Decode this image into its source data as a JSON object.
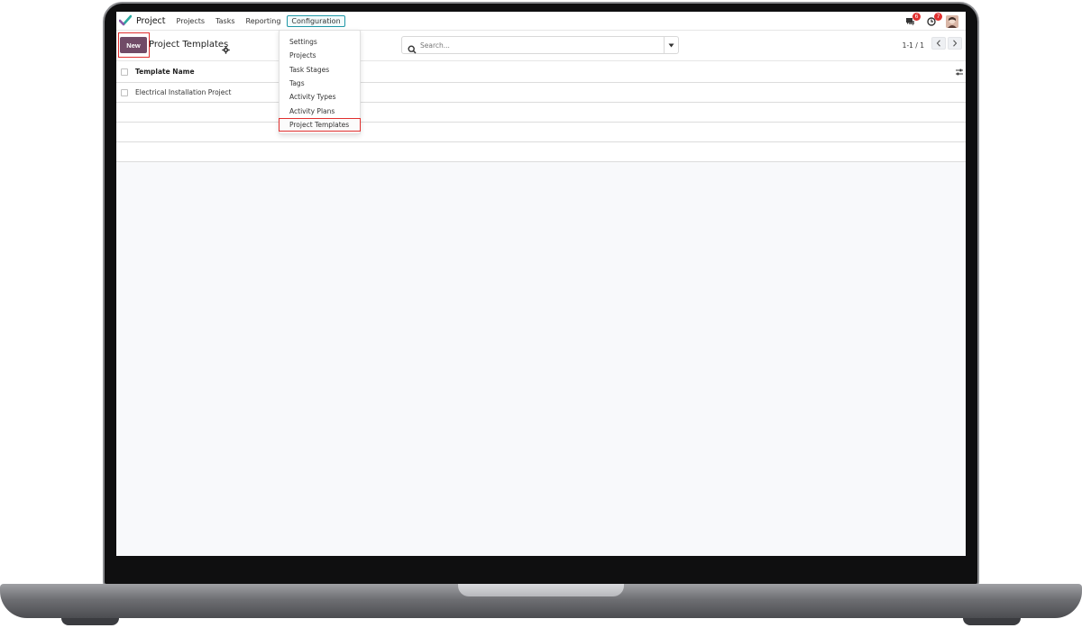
{
  "navbar": {
    "app_name": "Project",
    "menu": [
      "Projects",
      "Tasks",
      "Reporting",
      "Configuration"
    ],
    "messages_badge": "6",
    "activities_badge": "7"
  },
  "control_panel": {
    "new_label": "New",
    "breadcrumb": "Project Templates",
    "search_placeholder": "Search...",
    "pager": "1-1 / 1"
  },
  "configuration_menu": {
    "items": [
      "Settings",
      "Projects",
      "Task Stages",
      "Tags",
      "Activity Types",
      "Activity Plans",
      "Project Templates"
    ],
    "highlighted": "Project Templates"
  },
  "list": {
    "column_header": "Template Name",
    "rows": [
      "Electrical Installation Project"
    ]
  },
  "colors": {
    "brand": "#714b67",
    "highlight": "#e0302f",
    "active_menu_border": "#1f97a7"
  },
  "icons": {
    "app_logo": "checkmark-logo-icon",
    "messages": "chat-icon",
    "activities": "clock-icon",
    "settings": "gear-icon",
    "search": "search-icon",
    "dropdown": "caret-down-icon",
    "pager_prev": "chevron-left-icon",
    "pager_next": "chevron-right-icon",
    "optional_columns": "sliders-icon"
  }
}
